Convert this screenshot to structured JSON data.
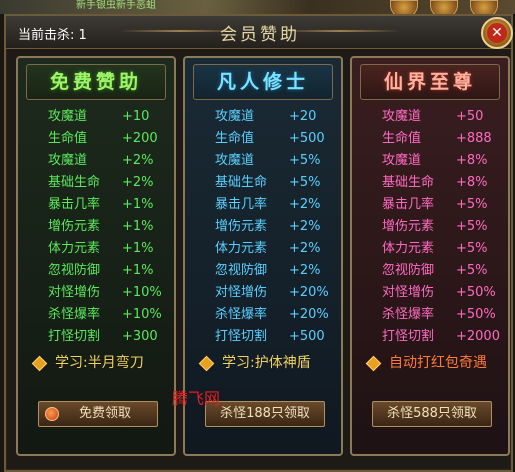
{
  "top_banner": "新手银虫新手恶蛆",
  "kill_count": "当前击杀: 1",
  "window_title": "会员赞助",
  "panels": [
    {
      "title": "免费赞助",
      "stats": [
        {
          "k": "攻魔道",
          "v": "+10"
        },
        {
          "k": "生命值",
          "v": "+200"
        },
        {
          "k": "攻魔道",
          "v": "+2%"
        },
        {
          "k": "基础生命",
          "v": "+2%"
        },
        {
          "k": "暴击几率",
          "v": "+1%"
        },
        {
          "k": "增伤元素",
          "v": "+1%"
        },
        {
          "k": "体力元素",
          "v": "+1%"
        },
        {
          "k": "忽视防御",
          "v": "+1%"
        },
        {
          "k": "对怪增伤",
          "v": "+10%"
        },
        {
          "k": "杀怪爆率",
          "v": "+10%"
        },
        {
          "k": "打怪切割",
          "v": "+300"
        }
      ],
      "learn": "学习:半月弯刀",
      "button": "免费领取"
    },
    {
      "title": "凡人修士",
      "stats": [
        {
          "k": "攻魔道",
          "v": "+20"
        },
        {
          "k": "生命值",
          "v": "+500"
        },
        {
          "k": "攻魔道",
          "v": "+5%"
        },
        {
          "k": "基础生命",
          "v": "+5%"
        },
        {
          "k": "暴击几率",
          "v": "+2%"
        },
        {
          "k": "增伤元素",
          "v": "+2%"
        },
        {
          "k": "体力元素",
          "v": "+2%"
        },
        {
          "k": "忽视防御",
          "v": "+2%"
        },
        {
          "k": "对怪增伤",
          "v": "+20%"
        },
        {
          "k": "杀怪爆率",
          "v": "+20%"
        },
        {
          "k": "打怪切割",
          "v": "+500"
        }
      ],
      "learn": "学习:护体神盾",
      "button": "杀怪188只领取"
    },
    {
      "title": "仙界至尊",
      "stats": [
        {
          "k": "攻魔道",
          "v": "+50"
        },
        {
          "k": "生命值",
          "v": "+888"
        },
        {
          "k": "攻魔道",
          "v": "+8%"
        },
        {
          "k": "基础生命",
          "v": "+8%"
        },
        {
          "k": "暴击几率",
          "v": "+5%"
        },
        {
          "k": "增伤元素",
          "v": "+5%"
        },
        {
          "k": "体力元素",
          "v": "+5%"
        },
        {
          "k": "忽视防御",
          "v": "+5%"
        },
        {
          "k": "对怪增伤",
          "v": "+50%"
        },
        {
          "k": "杀怪爆率",
          "v": "+50%"
        },
        {
          "k": "打怪切割",
          "v": "+2000"
        }
      ],
      "learn": "自动打红包奇遇",
      "button": "杀怪588只领取"
    }
  ],
  "watermark": "腾飞网",
  "icons": [
    "close-icon",
    "gem-icon"
  ]
}
